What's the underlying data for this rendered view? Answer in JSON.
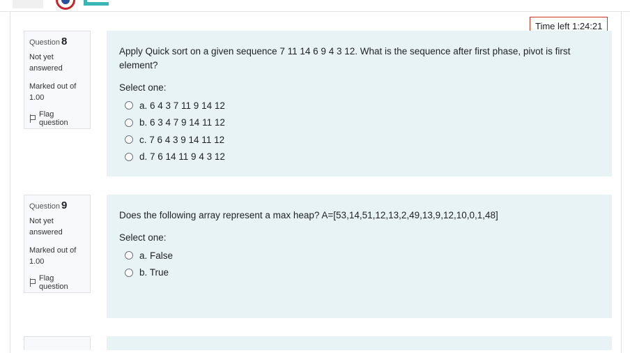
{
  "timer": {
    "label": "Time left 1:24:21"
  },
  "questions": [
    {
      "qno_prefix": "Question",
      "number": "8",
      "state": "Not yet answered",
      "grade": "Marked out of 1.00",
      "flag_label": "Flag question",
      "text": "Apply Quick sort on a given sequence 7 11 14 6 9 4 3 12. What is the sequence after first phase, pivot is first element?",
      "prompt": "Select one:",
      "options": [
        {
          "label": "a. 6 4 3 7 11 9 14 12"
        },
        {
          "label": "b. 6 3 4 7 9 14 11 12"
        },
        {
          "label": "c. 7 6 4 3 9 14 11 12"
        },
        {
          "label": "d. 7 6 14 11 9 4 3 12"
        }
      ]
    },
    {
      "qno_prefix": "Question",
      "number": "9",
      "state": "Not yet answered",
      "grade": "Marked out of 1.00",
      "flag_label": "Flag question",
      "text": "Does the following array represent a max heap? A=[53,14,51,12,13,2,49,13,9,12,10,0,1,48]",
      "prompt": "Select one:",
      "options": [
        {
          "label": "a. False"
        },
        {
          "label": "b. True"
        }
      ]
    }
  ],
  "colors": {
    "content_bg": "#e7f3f5",
    "info_bg": "#f8f9fa",
    "timer_border": "#ca3120"
  }
}
